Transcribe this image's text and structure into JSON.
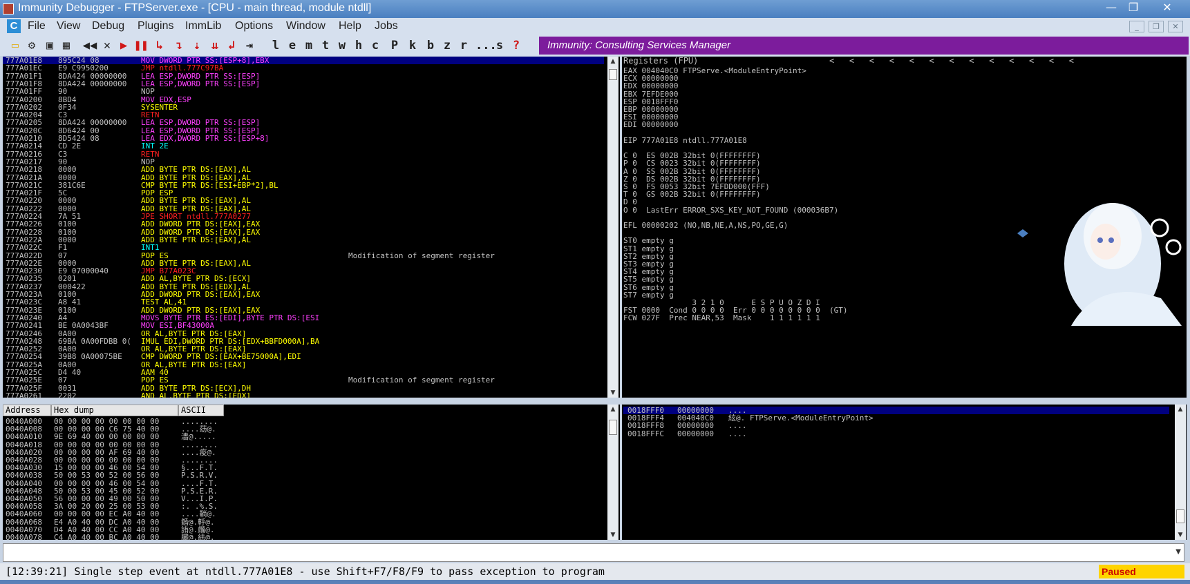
{
  "window": {
    "title": "Immunity Debugger - FTPServer.exe - [CPU - main thread, module ntdll]",
    "minimize": "—",
    "maximize": "❐",
    "close": "✕"
  },
  "menu": {
    "app_icon": "C",
    "items": [
      "File",
      "View",
      "Debug",
      "Plugins",
      "ImmLib",
      "Options",
      "Window",
      "Help",
      "Jobs"
    ]
  },
  "toolbar": {
    "icons": [
      "open-icon",
      "attach-icon",
      "close-file-icon",
      "grid-icon",
      "rewind-icon",
      "stop-icon",
      "run-icon",
      "pause-icon",
      "step-into-icon",
      "step-over-icon",
      "trace-into-icon",
      "trace-over-icon",
      "execute-till-return-icon",
      "goto-icon"
    ],
    "letters": [
      "l",
      "e",
      "m",
      "t",
      "w",
      "h",
      "c",
      "P",
      "k",
      "b",
      "z",
      "r",
      "...",
      "s",
      "?"
    ]
  },
  "banner": "Immunity: Consulting Services Manager",
  "disasm": {
    "rows": [
      {
        "addr": "777A01E8",
        "hex": "895C24 08",
        "instr": "MOV DWORD PTR SS:[ESP+8],EBX",
        "kind": "mov",
        "comment": "",
        "selected": true
      },
      {
        "addr": "777A01EC",
        "hex": "E9 C9950200",
        "instr": "JMP ntdll.777C97BA",
        "kind": "jmp",
        "comment": ""
      },
      {
        "addr": "777A01F1",
        "hex": "8DA424 00000000",
        "instr": "LEA ESP,DWORD PTR SS:[ESP]",
        "kind": "lea",
        "comment": ""
      },
      {
        "addr": "777A01F8",
        "hex": "8DA424 00000000",
        "instr": "LEA ESP,DWORD PTR SS:[ESP]",
        "kind": "lea",
        "comment": ""
      },
      {
        "addr": "777A01FF",
        "hex": "90",
        "instr": "NOP",
        "kind": "nop",
        "comment": ""
      },
      {
        "addr": "777A0200",
        "hex": "8BD4",
        "instr": "MOV EDX,ESP",
        "kind": "mov",
        "comment": ""
      },
      {
        "addr": "777A0202",
        "hex": "0F34",
        "instr": "SYSENTER",
        "kind": "sys",
        "comment": ""
      },
      {
        "addr": "777A0204",
        "hex": "C3",
        "instr": "RETN",
        "kind": "ret",
        "comment": ""
      },
      {
        "addr": "777A0205",
        "hex": "8DA424 00000000",
        "instr": "LEA ESP,DWORD PTR SS:[ESP]",
        "kind": "lea",
        "comment": ""
      },
      {
        "addr": "777A020C",
        "hex": "8D6424 00",
        "instr": "LEA ESP,DWORD PTR SS:[ESP]",
        "kind": "lea",
        "comment": ""
      },
      {
        "addr": "777A0210",
        "hex": "8D5424 08",
        "instr": "LEA EDX,DWORD PTR SS:[ESP+8]",
        "kind": "lea",
        "comment": ""
      },
      {
        "addr": "777A0214",
        "hex": "CD 2E",
        "instr": "INT 2E",
        "kind": "int",
        "comment": ""
      },
      {
        "addr": "777A0216",
        "hex": "C3",
        "instr": "RETN",
        "kind": "ret",
        "comment": ""
      },
      {
        "addr": "777A0217",
        "hex": "90",
        "instr": "NOP",
        "kind": "nop",
        "comment": ""
      },
      {
        "addr": "777A0218",
        "hex": "0000",
        "instr": "ADD BYTE PTR DS:[EAX],AL",
        "kind": "add",
        "comment": ""
      },
      {
        "addr": "777A021A",
        "hex": "0000",
        "instr": "ADD BYTE PTR DS:[EAX],AL",
        "kind": "add",
        "comment": ""
      },
      {
        "addr": "777A021C",
        "hex": "381C6E",
        "instr": "CMP BYTE PTR DS:[ESI+EBP*2],BL",
        "kind": "cmp",
        "comment": ""
      },
      {
        "addr": "777A021F",
        "hex": "5C",
        "instr": "POP ESP",
        "kind": "pop",
        "comment": ""
      },
      {
        "addr": "777A0220",
        "hex": "0000",
        "instr": "ADD BYTE PTR DS:[EAX],AL",
        "kind": "add",
        "comment": ""
      },
      {
        "addr": "777A0222",
        "hex": "0000",
        "instr": "ADD BYTE PTR DS:[EAX],AL",
        "kind": "add",
        "comment": ""
      },
      {
        "addr": "777A0224",
        "hex": "7A 51",
        "instr": "JPE SHORT ntdll.777A0277",
        "kind": "jmp",
        "comment": ""
      },
      {
        "addr": "777A0226",
        "hex": "0100",
        "instr": "ADD DWORD PTR DS:[EAX],EAX",
        "kind": "add",
        "comment": ""
      },
      {
        "addr": "777A0228",
        "hex": "0100",
        "instr": "ADD DWORD PTR DS:[EAX],EAX",
        "kind": "add",
        "comment": ""
      },
      {
        "addr": "777A022A",
        "hex": "0000",
        "instr": "ADD BYTE PTR DS:[EAX],AL",
        "kind": "add",
        "comment": ""
      },
      {
        "addr": "777A022C",
        "hex": "F1",
        "instr": "INT1",
        "kind": "int",
        "comment": ""
      },
      {
        "addr": "777A022D",
        "hex": "07",
        "instr": "POP ES",
        "kind": "pop",
        "comment": "Modification of segment register"
      },
      {
        "addr": "777A022E",
        "hex": "0000",
        "instr": "ADD BYTE PTR DS:[EAX],AL",
        "kind": "add",
        "comment": ""
      },
      {
        "addr": "777A0230",
        "hex": "E9 07000040",
        "instr": "JMP B77A023C",
        "kind": "jmp",
        "comment": ""
      },
      {
        "addr": "777A0235",
        "hex": "0201",
        "instr": "ADD AL,BYTE PTR DS:[ECX]",
        "kind": "add",
        "comment": ""
      },
      {
        "addr": "777A0237",
        "hex": "000422",
        "instr": "ADD BYTE PTR DS:[EDX],AL",
        "kind": "add",
        "comment": ""
      },
      {
        "addr": "777A023A",
        "hex": "0100",
        "instr": "ADD DWORD PTR DS:[EAX],EAX",
        "kind": "add",
        "comment": ""
      },
      {
        "addr": "777A023C",
        "hex": "A8 41",
        "instr": "TEST AL,41",
        "kind": "cmp",
        "comment": ""
      },
      {
        "addr": "777A023E",
        "hex": "0100",
        "instr": "ADD DWORD PTR DS:[EAX],EAX",
        "kind": "add",
        "comment": ""
      },
      {
        "addr": "777A0240",
        "hex": "A4",
        "instr": "MOVS BYTE PTR ES:[EDI],BYTE PTR DS:[ESI",
        "kind": "mov",
        "comment": ""
      },
      {
        "addr": "777A0241",
        "hex": "BE 0A0043BF",
        "instr": "MOV ESI,BF43000A",
        "kind": "mov",
        "comment": ""
      },
      {
        "addr": "777A0246",
        "hex": "0A00",
        "instr": "OR AL,BYTE PTR DS:[EAX]",
        "kind": "add",
        "comment": ""
      },
      {
        "addr": "777A0248",
        "hex": "69BA 0A00FDBB 0(",
        "instr": "IMUL EDI,DWORD PTR DS:[EDX+BBFD000A],BA",
        "kind": "add",
        "comment": ""
      },
      {
        "addr": "777A0252",
        "hex": "0A00",
        "instr": "OR AL,BYTE PTR DS:[EAX]",
        "kind": "add",
        "comment": ""
      },
      {
        "addr": "777A0254",
        "hex": "39B8 0A00075BE",
        "instr": "CMP DWORD PTR DS:[EAX+BE75000A],EDI",
        "kind": "cmp",
        "comment": ""
      },
      {
        "addr": "777A025A",
        "hex": "0A00",
        "instr": "OR AL,BYTE PTR DS:[EAX]",
        "kind": "add",
        "comment": ""
      },
      {
        "addr": "777A025C",
        "hex": "D4 40",
        "instr": "AAM 40",
        "kind": "add",
        "comment": ""
      },
      {
        "addr": "777A025E",
        "hex": "07",
        "instr": "POP ES",
        "kind": "pop",
        "comment": "Modification of segment register"
      },
      {
        "addr": "777A025F",
        "hex": "0031",
        "instr": "ADD BYTE PTR DS:[ECX],DH",
        "kind": "add",
        "comment": ""
      },
      {
        "addr": "777A0261",
        "hex": "2202",
        "instr": "AND AL,BYTE PTR DS:[EDX]",
        "kind": "add",
        "comment": ""
      }
    ]
  },
  "registers": {
    "header": "Registers (FPU)",
    "header_arrows": "<   <   <   <   <   <   <   <   <   <   <   <   <",
    "lines": [
      "EAX 004040C0 FTPServe.<ModuleEntryPoint>",
      "ECX 00000000",
      "EDX 00000000",
      "EBX 7EFDE000",
      "ESP 0018FFF0",
      "EBP 00000000",
      "ESI 00000000",
      "EDI 00000000",
      "",
      "EIP 777A01E8 ntdll.777A01E8",
      "",
      "C 0  ES 002B 32bit 0(FFFFFFFF)",
      "P 0  CS 0023 32bit 0(FFFFFFFF)",
      "A 0  SS 002B 32bit 0(FFFFFFFF)",
      "Z 0  DS 002B 32bit 0(FFFFFFFF)",
      "S 0  FS 0053 32bit 7EFDD000(FFF)",
      "T 0  GS 002B 32bit 0(FFFFFFFF)",
      "D 0",
      "O 0  LastErr ERROR_SXS_KEY_NOT_FOUND (000036B7)",
      "",
      "EFL 00000202 (NO,NB,NE,A,NS,PO,GE,G)",
      "",
      "ST0 empty g",
      "ST1 empty g",
      "ST2 empty g",
      "ST3 empty g",
      "ST4 empty g",
      "ST5 empty g",
      "ST6 empty g",
      "ST7 empty g",
      "               3 2 1 0      E S P U O Z D I",
      "FST 0000  Cond 0 0 0 0  Err 0 0 0 0 0 0 0 0  (GT)",
      "FCW 027F  Prec NEAR,53  Mask    1 1 1 1 1 1"
    ]
  },
  "dump": {
    "headers": [
      "Address",
      "Hex dump",
      "ASCII"
    ],
    "rows": [
      [
        "0040A000",
        "00 00 00 00 00 00 00 00",
        "........"
      ],
      [
        "0040A008",
        "00 00 00 00 C6 75 40 00",
        "....苭@."
      ],
      [
        "0040A010",
        "9E 69 40 00 00 00 00 00",
        "瀒@....."
      ],
      [
        "0040A018",
        "00 00 00 00 00 00 00 00",
        "........"
      ],
      [
        "0040A020",
        "00 00 00 00 AF 69 40 00",
        "....痠@."
      ],
      [
        "0040A028",
        "00 00 00 00 00 00 00 00",
        "........"
      ],
      [
        "0040A030",
        "15 00 00 00 46 00 54 00",
        "§...F.T."
      ],
      [
        "0040A038",
        "50 00 53 00 52 00 56 00",
        "P.S.R.V."
      ],
      [
        "0040A040",
        "00 00 00 00 46 00 54 00",
        "....F.T."
      ],
      [
        "0040A048",
        "50 00 53 00 45 00 52 00",
        "P.S.E.R."
      ],
      [
        "0040A050",
        "56 00 00 00 49 00 50 00",
        "V...I.P."
      ],
      [
        "0040A058",
        "3A 00 20 00 25 00 53 00",
        ":. .%.S."
      ],
      [
        "0040A060",
        "00 00 00 00 EC A0 40 00",
        "....鞝@."
      ],
      [
        "0040A068",
        "E4 A0 40 00 DC A0 40 00",
        "錉@.軤@."
      ],
      [
        "0040A070",
        "D4 A0 40 00 CC A0 40 00",
        "詴@.虪@."
      ],
      [
        "0040A078",
        "C4 A0 40 00 BC A0 40 00",
        "臓@.紶@."
      ]
    ]
  },
  "stack": {
    "rows": [
      {
        "addr": "0018FFF0",
        "value": "00000000",
        "comment": "....",
        "selected": true
      },
      {
        "addr": "0018FFF4",
        "value": "004040C0",
        "comment": "絃@. FTPServe.<ModuleEntryPoint>",
        "selected": false
      },
      {
        "addr": "0018FFF8",
        "value": "00000000",
        "comment": "....",
        "selected": false
      },
      {
        "addr": "0018FFFC",
        "value": "00000000",
        "comment": "....",
        "selected": false
      }
    ]
  },
  "status": {
    "message": "[12:39:21] Single step event at ntdll.777A01E8 - use Shift+F7/F8/F9 to pass exception to program",
    "state": "Paused"
  },
  "colors": {
    "mov": "#ff40ff",
    "jmp": "#ff2020",
    "lea": "#ff40ff",
    "nop": "#c0c0c0",
    "sys": "#ffff00",
    "ret": "#ff2020",
    "int": "#00ffff",
    "add": "#ffff00",
    "cmp": "#ffff00",
    "pop": "#ffff00",
    "addr": "#c0c0c0",
    "hex": "#c0c0c0",
    "banner": "#7c1c9c",
    "select": "#000080"
  }
}
